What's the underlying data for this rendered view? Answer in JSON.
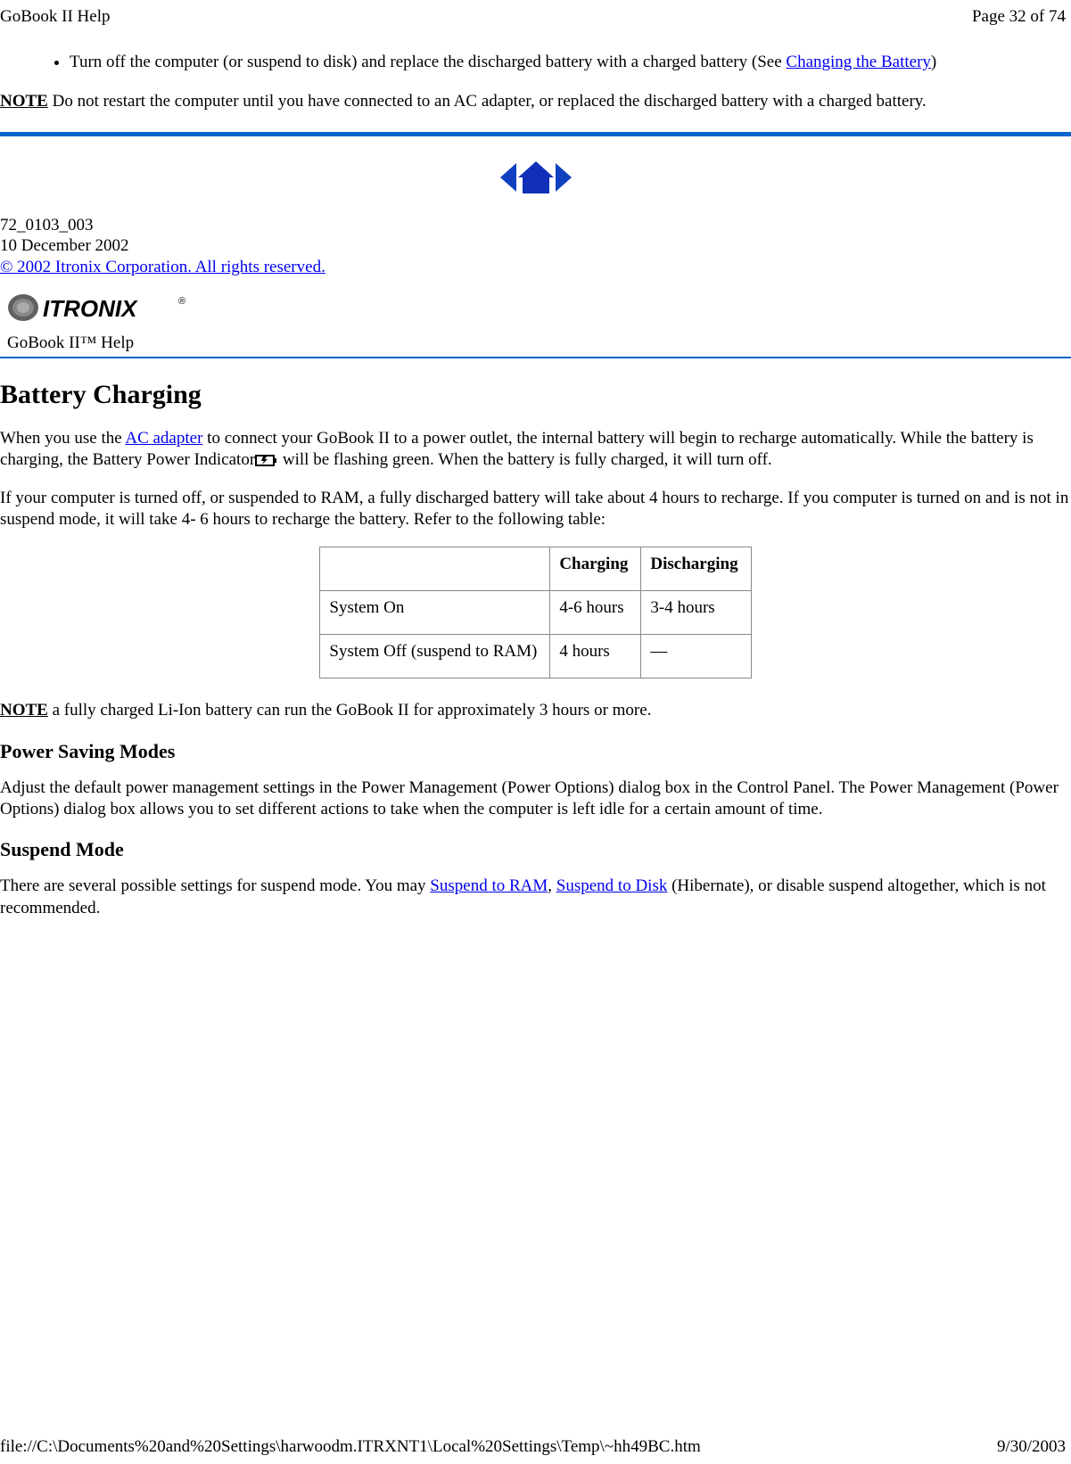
{
  "header": {
    "left": "GoBook II Help",
    "right": "Page 32 of 74"
  },
  "bullet": {
    "text_before_link": "Turn off the computer (or suspend to disk) and replace the discharged battery with a charged battery (See ",
    "link_text": "Changing the Battery",
    "text_after_link": ")"
  },
  "note1": {
    "label": "NOTE",
    "text": "  Do not restart the computer until you have connected to an AC adapter, or replaced the discharged battery with a charged battery."
  },
  "doc_meta": {
    "line1": "72_0103_003",
    "line2": "10 December 2002",
    "copyright_link": "© 2002 Itronix Corporation.  All rights reserved."
  },
  "help_title": "GoBook II™ Help",
  "section_title": "Battery Charging",
  "para1": {
    "before_link": "When you use the ",
    "link": "AC adapter",
    "after_link_before_icon": " to connect your GoBook II to a power outlet, the internal battery will begin to recharge automatically. While the battery is charging, the Battery Power Indicator",
    "after_icon": "  will be flashing green. When the battery is fully charged, it will turn off."
  },
  "para2": "If your computer is turned off, or suspended to RAM, a fully discharged battery will take about 4 hours to recharge.  If you computer is turned on and is not in suspend mode, it will take 4- 6 hours to recharge the battery.  Refer to the following table:",
  "table": {
    "headers": [
      "",
      "Charging",
      "Discharging"
    ],
    "rows": [
      [
        "System On",
        "4-6 hours",
        "3-4 hours"
      ],
      [
        "System Off (suspend to RAM)",
        "4 hours",
        "—"
      ]
    ]
  },
  "note2": {
    "label": "NOTE",
    "text": " a fully charged Li-Ion battery can run the GoBook II for approximately 3 hours or more."
  },
  "sub1_title": "Power Saving Modes",
  "sub1_para": "Adjust the default power management settings in the Power Management (Power Options) dialog box in the Control Panel.  The Power Management (Power Options) dialog box allows you to set different actions to take when the computer is left idle for a certain amount of time.",
  "sub2_title": "Suspend Mode",
  "sub2_para": {
    "before_link1": "There are several possible settings for suspend mode.  You may ",
    "link1": "Suspend to RAM",
    "between": ", ",
    "link2": "Suspend to Disk",
    "after_link2": " (Hibernate), or disable suspend altogether, which is not recommended."
  },
  "footer": {
    "left": "file://C:\\Documents%20and%20Settings\\harwoodm.ITRXNT1\\Local%20Settings\\Temp\\~hh49BC.htm",
    "right": "9/30/2003"
  }
}
